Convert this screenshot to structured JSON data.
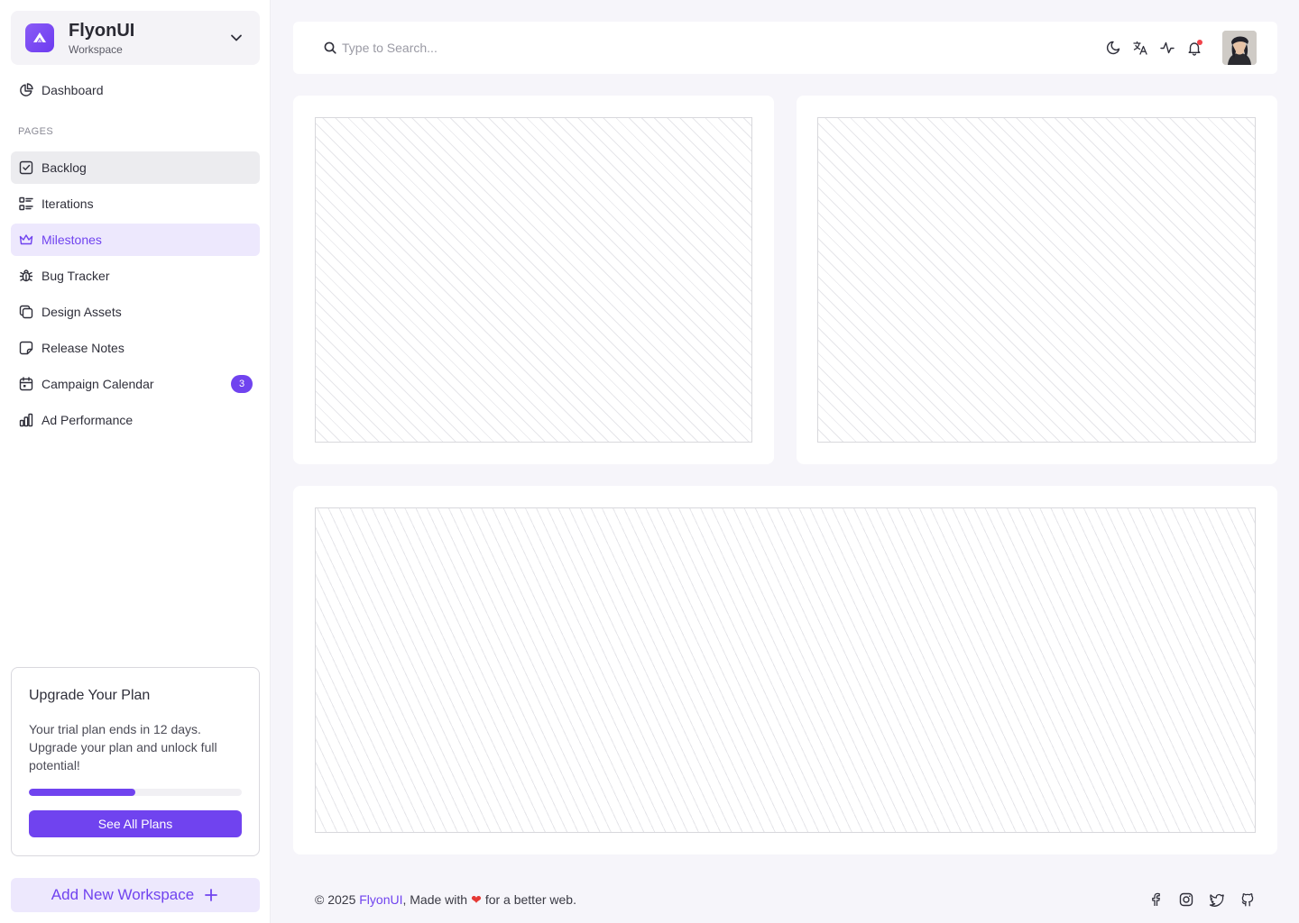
{
  "workspace": {
    "name": "FlyonUI",
    "subtitle": "Workspace"
  },
  "nav": {
    "dashboard": "Dashboard",
    "section_label": "PAGES",
    "items": [
      {
        "label": "Backlog",
        "icon": "checkbox-icon",
        "state": "hover"
      },
      {
        "label": "Iterations",
        "icon": "list-details-icon"
      },
      {
        "label": "Milestones",
        "icon": "crown-icon",
        "state": "active"
      },
      {
        "label": "Bug Tracker",
        "icon": "bug-icon"
      },
      {
        "label": "Design Assets",
        "icon": "copy-icon"
      },
      {
        "label": "Release Notes",
        "icon": "sticker-icon"
      },
      {
        "label": "Campaign Calendar",
        "icon": "calendar-icon",
        "badge": "3"
      },
      {
        "label": "Ad Performance",
        "icon": "chart-bar-icon"
      }
    ]
  },
  "upgrade": {
    "title": "Upgrade Your Plan",
    "text": "Your trial plan ends in 12 days. Upgrade your plan and unlock full potential!",
    "progress_percent": 50,
    "button": "See All Plans"
  },
  "add_workspace": "Add New Workspace",
  "header": {
    "search_placeholder": "Type to Search...",
    "icons": [
      "moon-icon",
      "language-icon",
      "activity-icon",
      "bell-icon"
    ]
  },
  "footer": {
    "copyright": "© 2025 ",
    "brand": "FlyonUI",
    "made_with": ", Made with",
    "tail": "for a better web.",
    "social": [
      "facebook-icon",
      "instagram-icon",
      "twitter-icon",
      "github-icon"
    ]
  },
  "colors": {
    "accent": "#7043ef",
    "accent_soft": "#ede8fd",
    "notification": "#f1434a"
  }
}
